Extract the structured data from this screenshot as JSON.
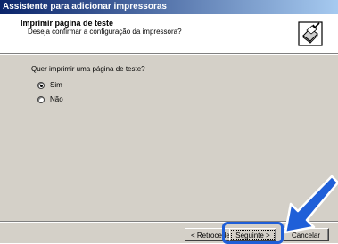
{
  "window": {
    "title": "Assistente para adicionar impressoras"
  },
  "header": {
    "title": "Imprimir página de teste",
    "subtitle": "Deseja confirmar a configuração da impressora?",
    "icon": "printer-check-icon"
  },
  "content": {
    "question": "Quer imprimir uma página de teste?",
    "options": [
      {
        "label": "Sim",
        "checked": true
      },
      {
        "label": "Não",
        "checked": false
      }
    ]
  },
  "buttons": {
    "back_label": "< Retroceder",
    "next_label": "Seguinte >",
    "cancel_label": "Cancelar"
  },
  "colors": {
    "title_bar_start": "#0a246a",
    "title_bar_end": "#a6caf0",
    "dialog_bg": "#d4d0c8",
    "highlight": "#1f5fd8",
    "arrow": "#1f5fd8"
  }
}
